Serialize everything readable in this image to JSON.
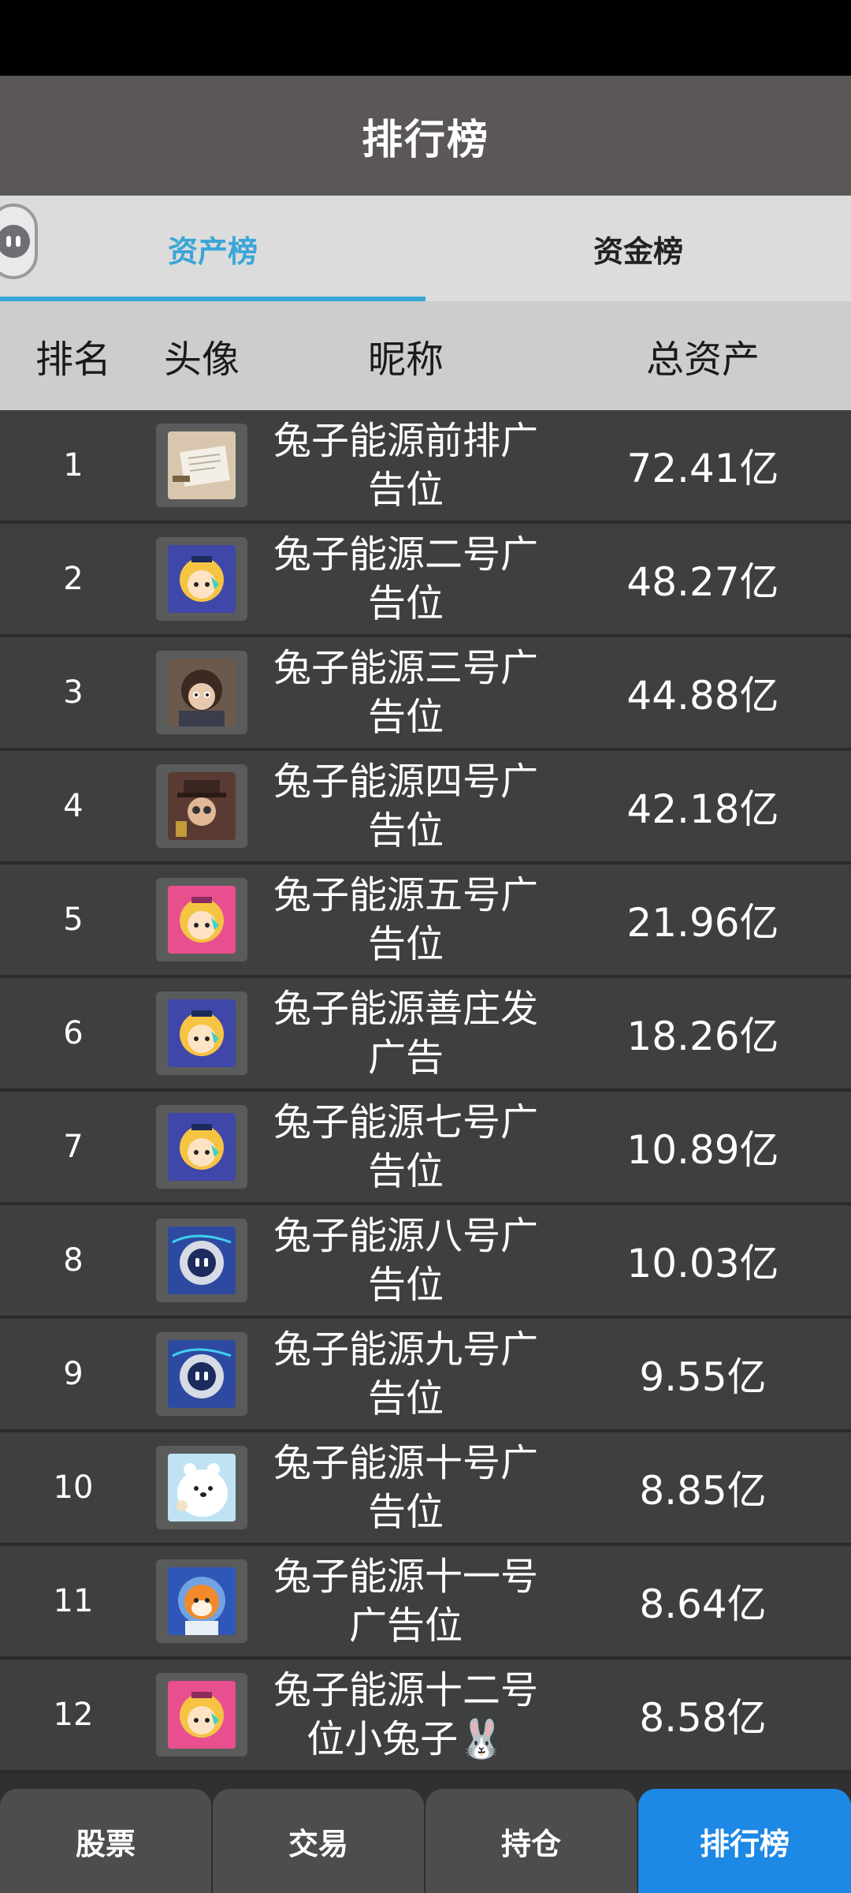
{
  "header": {
    "title": "排行榜"
  },
  "tabs": [
    {
      "label": "资产榜",
      "active": true
    },
    {
      "label": "资金榜",
      "active": false
    }
  ],
  "table": {
    "headers": {
      "rank": "排名",
      "avatar": "头像",
      "nickname": "昵称",
      "total": "总资产"
    },
    "rows": [
      {
        "rank": "1",
        "line1": "兔子能源前排广",
        "line2": "告位",
        "total": "72.41亿",
        "avatar": "document-photo-avatar"
      },
      {
        "rank": "2",
        "line1": "兔子能源二号广",
        "line2": "告位",
        "total": "48.27亿",
        "avatar": "blonde-girl-avatar"
      },
      {
        "rank": "3",
        "line1": "兔子能源三号广",
        "line2": "告位",
        "total": "44.88亿",
        "avatar": "dark-hair-character-avatar"
      },
      {
        "rank": "4",
        "line1": "兔子能源四号广",
        "line2": "告位",
        "total": "42.18亿",
        "avatar": "hat-character-avatar"
      },
      {
        "rank": "5",
        "line1": "兔子能源五号广",
        "line2": "告位",
        "total": "21.96亿",
        "avatar": "pink-blonde-girl-avatar"
      },
      {
        "rank": "6",
        "line1": "兔子能源善庄发",
        "line2": "广告",
        "total": "18.26亿",
        "avatar": "blonde-girl-avatar"
      },
      {
        "rank": "7",
        "line1": "兔子能源七号广",
        "line2": "告位",
        "total": "10.89亿",
        "avatar": "blonde-girl-avatar"
      },
      {
        "rank": "8",
        "line1": "兔子能源八号广",
        "line2": "告位",
        "total": "10.03亿",
        "avatar": "robot-avatar"
      },
      {
        "rank": "9",
        "line1": "兔子能源九号广",
        "line2": "告位",
        "total": "9.55亿",
        "avatar": "robot-avatar"
      },
      {
        "rank": "10",
        "line1": "兔子能源十号广",
        "line2": "告位",
        "total": "8.85亿",
        "avatar": "white-bear-avatar"
      },
      {
        "rank": "11",
        "line1": "兔子能源十一号",
        "line2": "广告位",
        "total": "8.64亿",
        "avatar": "shiba-astronaut-avatar"
      },
      {
        "rank": "12",
        "line1": "兔子能源十二号",
        "line2": "位小兔子🐰",
        "total": "8.58亿",
        "avatar": "pink-blonde-girl-avatar"
      }
    ]
  },
  "bottom_nav": [
    {
      "label": "股票",
      "active": false
    },
    {
      "label": "交易",
      "active": false
    },
    {
      "label": "持仓",
      "active": false
    },
    {
      "label": "排行榜",
      "active": true
    }
  ],
  "colors": {
    "accent_tab": "#3aa6d8",
    "nav_active": "#1e88e5",
    "header_bg": "#5a5756",
    "row_bg": "#3d403f"
  }
}
